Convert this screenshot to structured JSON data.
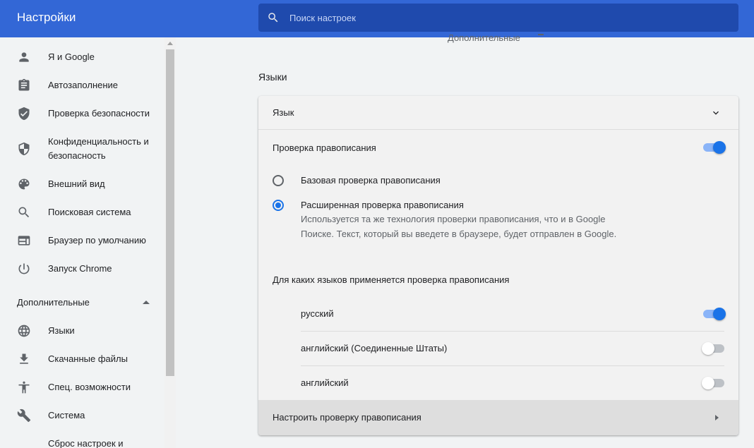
{
  "header": {
    "title": "Настройки"
  },
  "search": {
    "placeholder": "Поиск настроек"
  },
  "sidebar": {
    "items": [
      {
        "label": "Я и Google",
        "icon": "person-icon"
      },
      {
        "label": "Автозаполнение",
        "icon": "clipboard-icon"
      },
      {
        "label": "Проверка безопасности",
        "icon": "shield-check-icon"
      },
      {
        "label_line1": "Конфиденциальность и",
        "label_line2": "безопасность",
        "icon": "shield-half-icon"
      },
      {
        "label": "Внешний вид",
        "icon": "palette-icon"
      },
      {
        "label": "Поисковая система",
        "icon": "search-icon"
      },
      {
        "label": "Браузер по умолчанию",
        "icon": "browser-window-icon"
      },
      {
        "label": "Запуск Chrome",
        "icon": "power-icon"
      }
    ],
    "advanced_header": "Дополнительные",
    "advanced_items": [
      {
        "label": "Языки",
        "icon": "globe-icon"
      },
      {
        "label": "Скачанные файлы",
        "icon": "download-icon"
      },
      {
        "label": "Спец. возможности",
        "icon": "accessibility-icon"
      },
      {
        "label": "Система",
        "icon": "wrench-icon"
      },
      {
        "label": "Сброс настроек и",
        "icon": "reset-icon"
      }
    ]
  },
  "main": {
    "faded_header": "Дополнительные",
    "section_title": "Языки",
    "language_row": "Язык",
    "spellcheck": {
      "label": "Проверка правописания",
      "enabled": true,
      "basic_label": "Базовая проверка правописания",
      "enhanced_label": "Расширенная проверка правописания",
      "enhanced_desc": "Используется та же технология проверки правописания, что и в Google Поиске. Текст, который вы введете в браузере, будет отправлен в Google.",
      "selected": "enhanced",
      "languages_label": "Для каких языков применяется проверка правописания",
      "languages": [
        {
          "name": "русский",
          "enabled": true
        },
        {
          "name": "английский (Соединенные Штаты)",
          "enabled": false
        },
        {
          "name": "английский",
          "enabled": false
        }
      ],
      "customize_label": "Настроить проверку правописания"
    }
  },
  "colors": {
    "header": "#3367d6",
    "search_bg": "#1f4aad",
    "accent": "#1a73e8"
  }
}
